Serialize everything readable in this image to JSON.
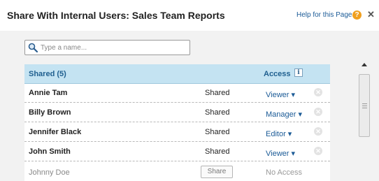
{
  "dialog": {
    "title": "Share With Internal Users: Sales Team Reports",
    "help_label": "Help for this Page",
    "help_icon": "question-icon",
    "close_icon": "close-icon"
  },
  "search": {
    "placeholder": "Type a name..."
  },
  "table": {
    "shared_header": "Shared (5)",
    "access_header": "Access",
    "info_icon_glyph": "i",
    "rows": [
      {
        "name": "Annie Tam",
        "status": "Shared",
        "access": "Viewer ▾"
      },
      {
        "name": "Billy Brown",
        "status": "Shared",
        "access": "Manager ▾"
      },
      {
        "name": "Jennifer Black",
        "status": "Shared",
        "access": "Editor ▾"
      },
      {
        "name": "John Smith",
        "status": "Shared",
        "access": "Viewer ▾"
      },
      {
        "name": "Johnny Doe",
        "share_button": "Share",
        "access": "No Access"
      }
    ]
  },
  "colors": {
    "header_bg": "#c4e3f2",
    "link": "#1a5a96",
    "help_icon": "#f0a020"
  }
}
